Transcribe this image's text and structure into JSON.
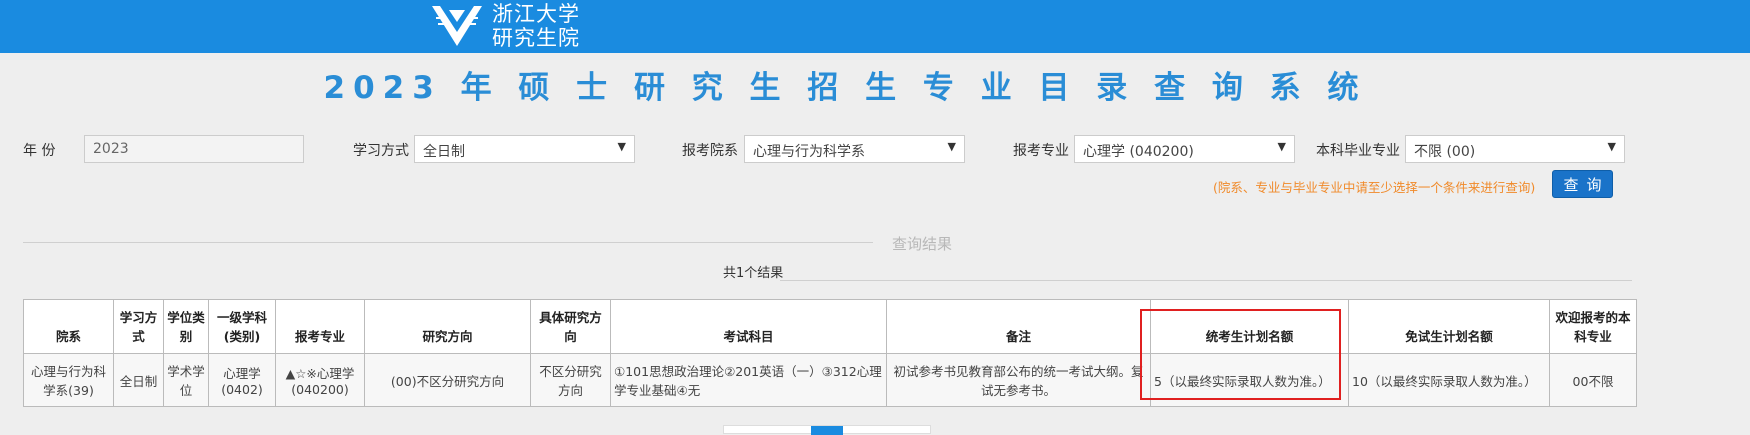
{
  "header": {
    "logo_line1": "浙江大学",
    "logo_line2": "研究生院",
    "brand_color": "#1a8be0"
  },
  "page_title": "2023 年 硕 士 研 究 生 招 生 专 业 目 录 查 询 系 统",
  "filters": {
    "year_label": "年    份",
    "year_value": "2023",
    "study_mode_label": "学习方式",
    "study_mode_value": "全日制",
    "dept_label": "报考院系",
    "dept_value": "心理与行为科学系",
    "major_label": "报考专业",
    "major_value": "心理学 (040200)",
    "undergrad_label": "本科毕业专业",
    "undergrad_value": "不限 (00)"
  },
  "hint": "(院系、专业与毕业专业中请至少选择一个条件来进行查询)",
  "query_button": "查询",
  "results": {
    "title": "查询结果",
    "count": "共1个结果",
    "headers": [
      "院系",
      "学习方式",
      "学位类别",
      "一级学科(类别)",
      "报考专业",
      "研究方向",
      "具体研究方向",
      "考试科目",
      "备注",
      "统考生计划名额",
      "免试生计划名额",
      "欢迎报考的本科专业"
    ],
    "rows": [
      [
        "心理与行为科学系(39)",
        "全日制",
        "学术学位",
        "心理学(0402)",
        "▲☆※心理学(040200)",
        "(00)不区分研究方向",
        "不区分研究方向",
        "①101思想政治理论②201英语（一）③312心理学专业基础④无",
        "初试参考书见教育部公布的统一考试大纲。复试无参考书。",
        "5（以最终实际录取人数为准。）",
        "10（以最终实际录取人数为准。）",
        "00不限"
      ]
    ]
  }
}
